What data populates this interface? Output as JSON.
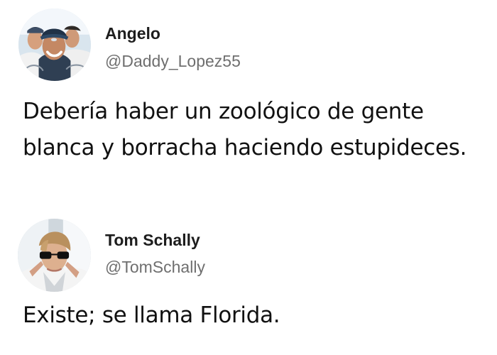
{
  "tweets": [
    {
      "display_name": "Angelo",
      "handle": "@Daddy_Lopez55",
      "text": "Debería haber un zoológico de gente blanca y borracha haciendo estupideces.",
      "avatar_icon": "group-selfie-avatar"
    },
    {
      "display_name": "Tom Schally",
      "handle": "@TomSchally",
      "text": "Existe; se llama Florida.",
      "avatar_icon": "sunglasses-person-avatar"
    }
  ],
  "colors": {
    "background": "#ffffff",
    "text": "#111111",
    "name": "#1d1d1d",
    "handle": "#6f6f6f"
  }
}
